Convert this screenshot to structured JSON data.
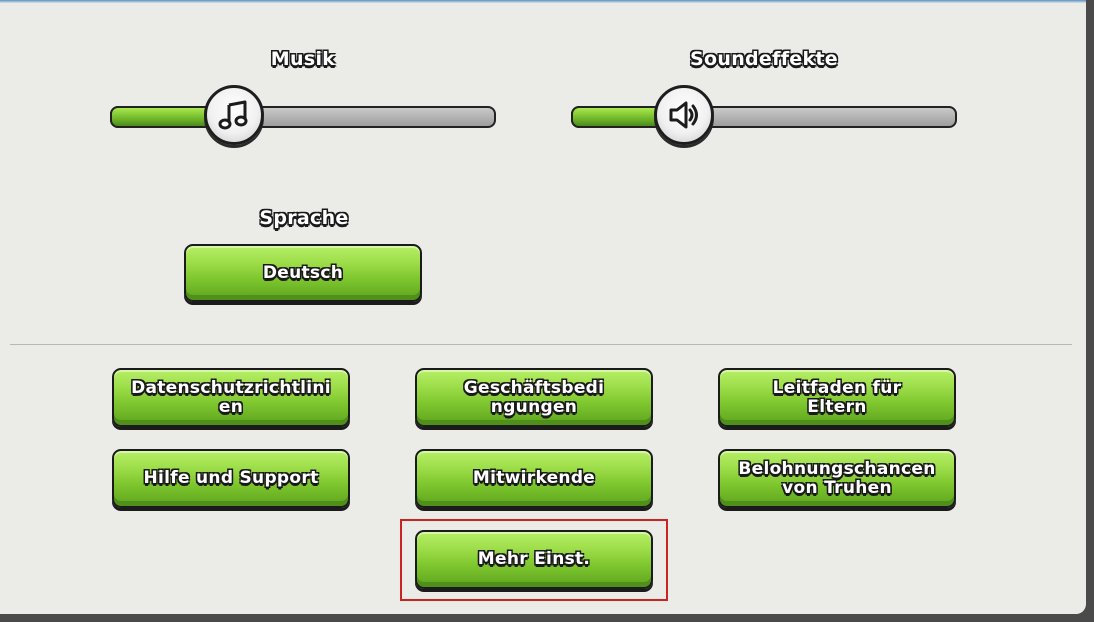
{
  "audio": {
    "music": {
      "label": "Musik",
      "level_percent": 26,
      "icon": "music-note-icon"
    },
    "sfx": {
      "label": "Soundeffekte",
      "level_percent": 26,
      "icon": "speaker-icon"
    }
  },
  "language": {
    "label": "Sprache",
    "value": "Deutsch"
  },
  "buttons": {
    "privacy": "Datenschutzrichtlinien",
    "terms": "Geschäftsbedingungen",
    "parents_guide": "Leitfaden für Eltern",
    "help": "Hilfe und Support",
    "credits": "Mitwirkende",
    "chest_odds": "Belohnungschancen von Truhen",
    "more_settings": "Mehr Einst."
  },
  "colors": {
    "button_green": "#7fc72f",
    "panel_bg": "#ebebe8",
    "highlight_red": "#cc2222"
  }
}
